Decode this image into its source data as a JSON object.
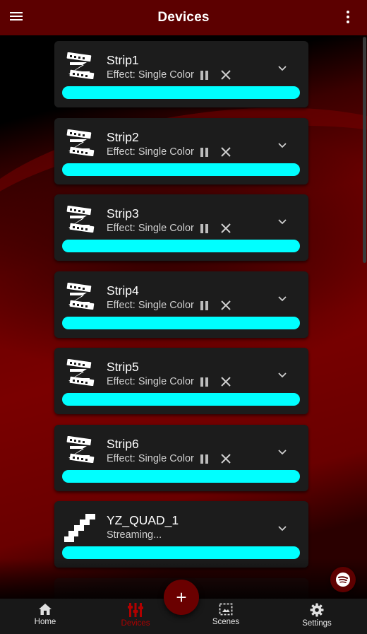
{
  "header": {
    "title": "Devices"
  },
  "devices": [
    {
      "name": "Strip1",
      "subtitle": "Effect: Single Color",
      "icon": "led-strip-icon",
      "bar_color": "#00ffff",
      "has_controls": true
    },
    {
      "name": "Strip2",
      "subtitle": "Effect: Single Color",
      "icon": "led-strip-icon",
      "bar_color": "#00ffff",
      "has_controls": true
    },
    {
      "name": "Strip3",
      "subtitle": "Effect: Single Color",
      "icon": "led-strip-icon",
      "bar_color": "#00ffff",
      "has_controls": true
    },
    {
      "name": "Strip4",
      "subtitle": "Effect: Single Color",
      "icon": "led-strip-icon",
      "bar_color": "#00ffff",
      "has_controls": true
    },
    {
      "name": "Strip5",
      "subtitle": "Effect: Single Color",
      "icon": "led-strip-icon",
      "bar_color": "#00ffff",
      "has_controls": true
    },
    {
      "name": "Strip6",
      "subtitle": "Effect: Single Color",
      "icon": "led-strip-icon",
      "bar_color": "#00ffff",
      "has_controls": true
    },
    {
      "name": "YZ_QUAD_1",
      "subtitle": "Streaming...",
      "icon": "stairs-icon",
      "bar_color": "#00ffff",
      "has_controls": false
    }
  ],
  "fab": {
    "label": "+"
  },
  "bottom_nav": [
    {
      "label": "Home",
      "icon": "home-icon",
      "active": false
    },
    {
      "label": "Devices",
      "icon": "devices-icon",
      "active": true
    },
    {
      "label": "Scenes",
      "icon": "scenes-icon",
      "active": false
    },
    {
      "label": "Settings",
      "icon": "settings-icon",
      "active": false
    }
  ],
  "colors": {
    "accent": "#5c0000",
    "active_nav": "#b00000",
    "bar": "#00ffff",
    "card_bg": "#1c1c1c"
  }
}
